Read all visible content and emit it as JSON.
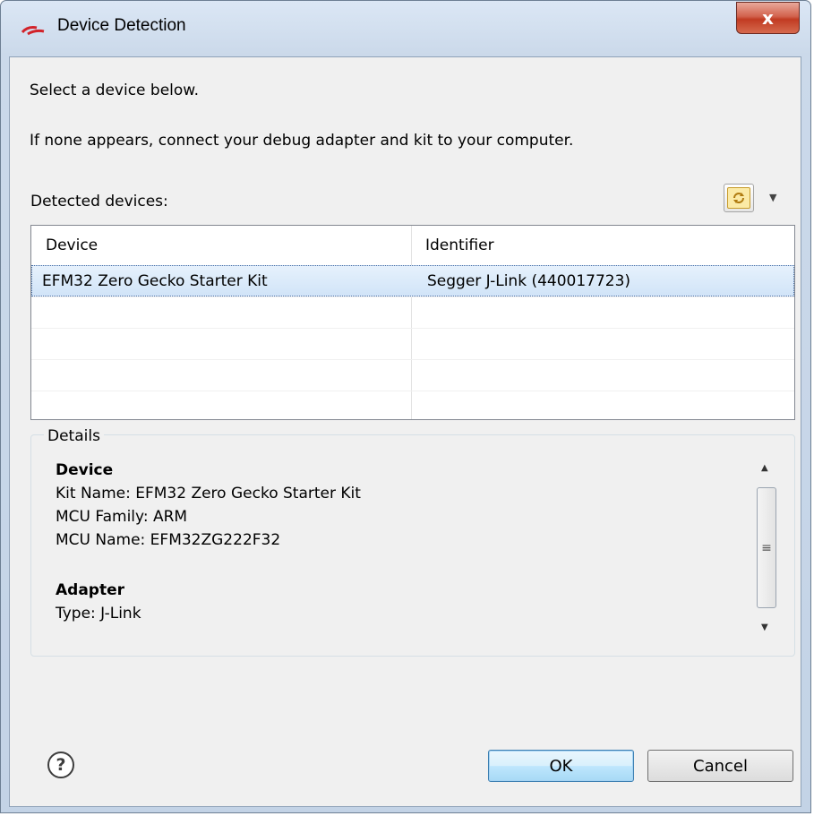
{
  "window": {
    "title": "Device Detection",
    "close_label": "x"
  },
  "messages": {
    "line1": "Select a device below.",
    "line2": "If none appears, connect your debug adapter and kit to your computer."
  },
  "detected": {
    "label": "Detected devices:",
    "refresh_icon": "refresh-icon",
    "dropdown_glyph": "▼"
  },
  "table": {
    "columns": [
      "Device",
      "Identifier"
    ],
    "rows": [
      {
        "device": "EFM32 Zero Gecko Starter Kit",
        "identifier": "Segger J-Link (440017723)",
        "selected": true
      }
    ]
  },
  "details": {
    "legend": "Details",
    "device_heading": "Device",
    "kit_name": "Kit Name: EFM32 Zero Gecko Starter Kit",
    "mcu_family": "MCU Family: ARM",
    "mcu_name": "MCU Name: EFM32ZG222F32",
    "adapter_heading": "Adapter",
    "adapter_type": "Type: J-Link"
  },
  "buttons": {
    "help": "?",
    "ok": "OK",
    "cancel": "Cancel"
  },
  "colors": {
    "selection": "#d1e4f8",
    "close_button": "#c13b22"
  }
}
